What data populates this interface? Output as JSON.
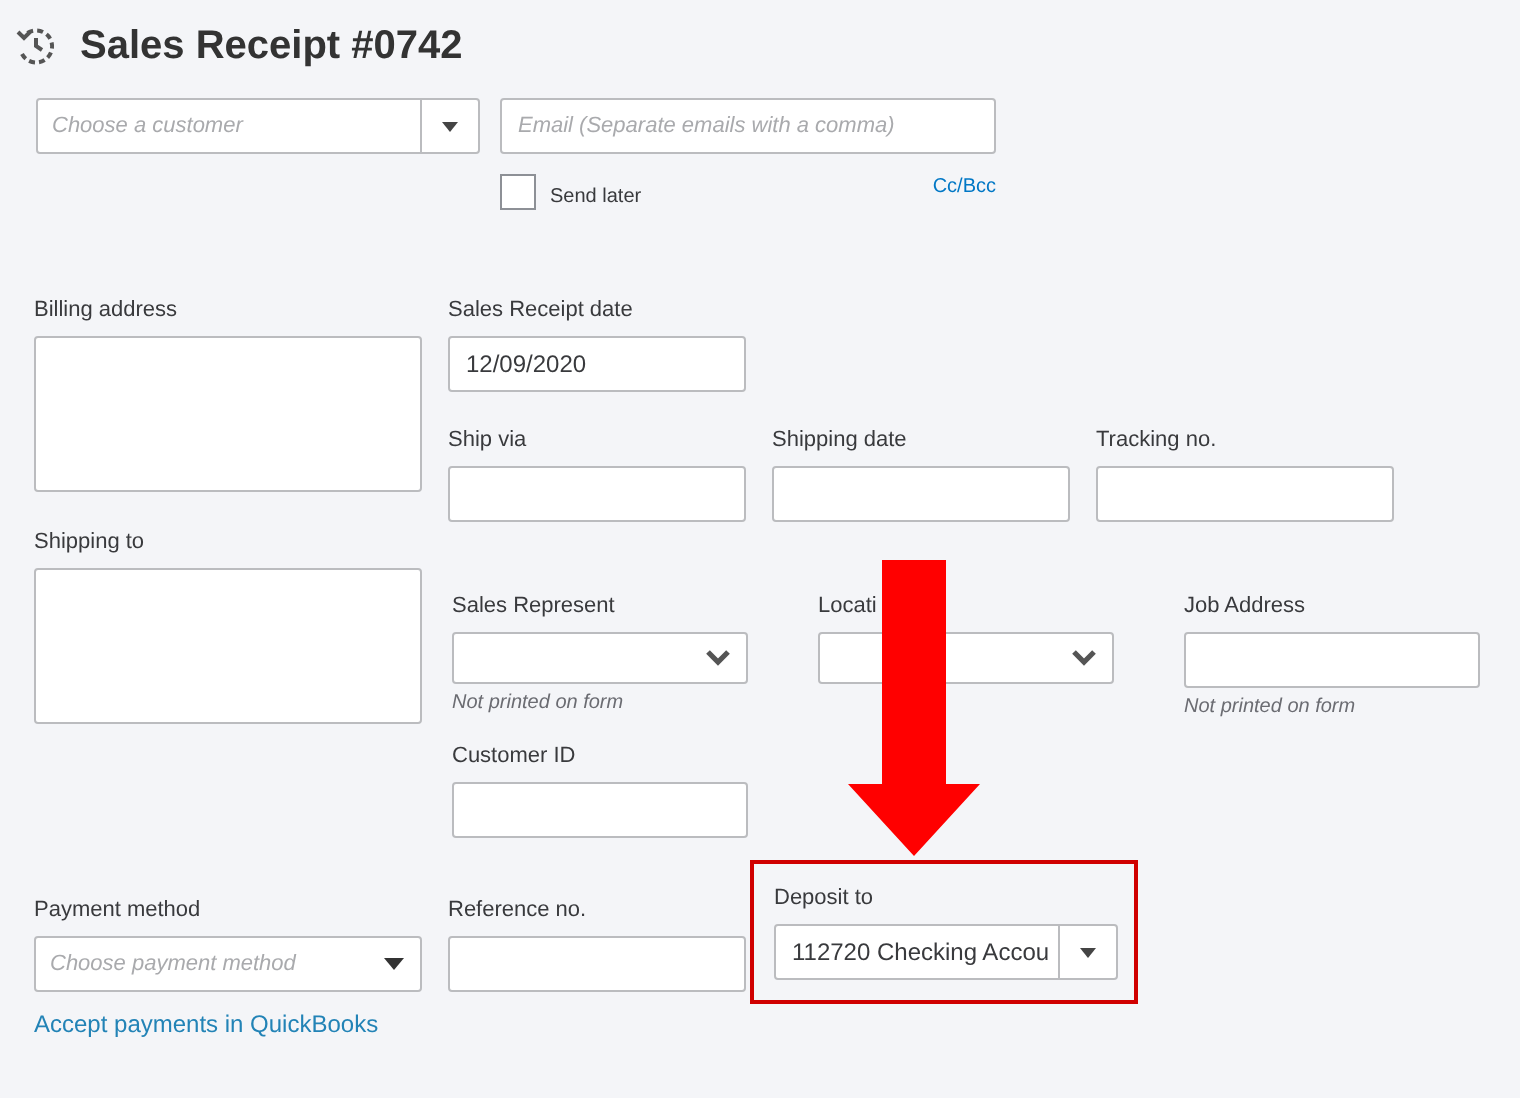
{
  "title": "Sales Receipt #0742",
  "customer": {
    "placeholder": "Choose a customer"
  },
  "email": {
    "placeholder": "Email (Separate emails with a comma)"
  },
  "send_later": {
    "label": "Send later",
    "checked": false
  },
  "cc_bcc": "Cc/Bcc",
  "billing_address": {
    "label": "Billing address"
  },
  "shipping_to": {
    "label": "Shipping to"
  },
  "receipt_date": {
    "label": "Sales Receipt date",
    "value": "12/09/2020"
  },
  "shipping_fields": [
    {
      "label": "Ship via"
    },
    {
      "label": "Shipping date"
    },
    {
      "label": "Tracking no."
    }
  ],
  "custom_fields": [
    {
      "label": "Sales Represent",
      "kind": "dropdown",
      "note": "Not printed on form"
    },
    {
      "label": "Locati",
      "kind": "dropdown"
    },
    {
      "label": "Job Address",
      "kind": "text",
      "note": "Not printed on form"
    }
  ],
  "customer_id": {
    "label": "Customer ID"
  },
  "payment_method": {
    "label": "Payment method",
    "placeholder": "Choose payment method"
  },
  "reference_no": {
    "label": "Reference no."
  },
  "deposit_to": {
    "label": "Deposit to",
    "value": "112720 Checking Accou",
    "highlighted": true
  },
  "accept_payments_link": "Accept payments in QuickBooks",
  "annotations": [
    {
      "kind": "arrow",
      "color": "#ff0000"
    }
  ]
}
